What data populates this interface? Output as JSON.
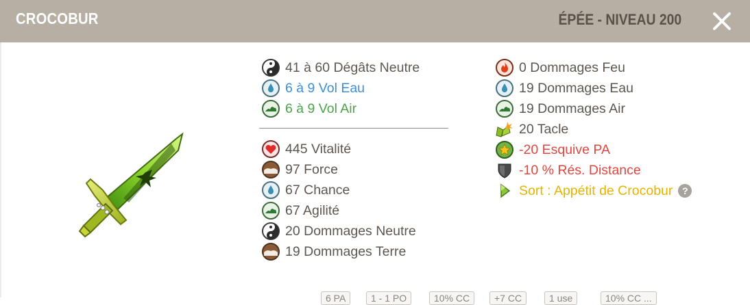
{
  "header": {
    "title": "CROCOBUR",
    "subtitle": "ÉPÉE - NIVEAU 200",
    "close_icon": "close-icon"
  },
  "item": {
    "image_icon": "sword-icon"
  },
  "weapon_effects": [
    {
      "text": "41 à 60 Dégâts Neutre",
      "icon": "neutral-icon",
      "color": "#5d5650"
    },
    {
      "text": "6 à 9 Vol Eau",
      "icon": "water-icon",
      "color": "#3a8ed6"
    },
    {
      "text": "6 à 9 Vol Air",
      "icon": "air-icon",
      "color": "#4aa34a"
    }
  ],
  "stats": [
    {
      "text": "445 Vitalité",
      "icon": "vitality-heart-icon"
    },
    {
      "text": "97 Force",
      "icon": "earth-icon"
    },
    {
      "text": "67 Chance",
      "icon": "water-icon"
    },
    {
      "text": "67 Agilité",
      "icon": "air-icon"
    },
    {
      "text": "20 Dommages Neutre",
      "icon": "neutral-icon"
    },
    {
      "text": "19 Dommages Terre",
      "icon": "earth-icon"
    }
  ],
  "right_stats": [
    {
      "text": "0 Dommages Feu",
      "icon": "fire-icon",
      "color": "#5d5650"
    },
    {
      "text": "19 Dommages Eau",
      "icon": "water-icon",
      "color": "#5d5650"
    },
    {
      "text": "19 Dommages Air",
      "icon": "air-icon",
      "color": "#5d5650"
    },
    {
      "text": "20 Tacle",
      "icon": "tackle-icon",
      "color": "#5d5650"
    },
    {
      "text": "-20 Esquive PA",
      "icon": "dodge-pa-star-icon",
      "color": "#e0463d"
    },
    {
      "text": "-10 % Rés. Distance",
      "icon": "shield-icon",
      "color": "#e0463d"
    },
    {
      "text": "Sort : Appétit de Crocobur",
      "icon": "spell-arrow-icon",
      "color": "#e4b400"
    }
  ],
  "help_label": "?",
  "chips": [
    "6 PA",
    "1 - 1 PO",
    "10% CC",
    "+7 CC",
    "1 use",
    "10% CC ..."
  ],
  "colors": {
    "header_bg": "#b7aea4",
    "neutral_text": "#5d5650",
    "water": "#3a8ed6",
    "air": "#4aa34a",
    "negative": "#e0463d",
    "spell": "#e4b400"
  }
}
